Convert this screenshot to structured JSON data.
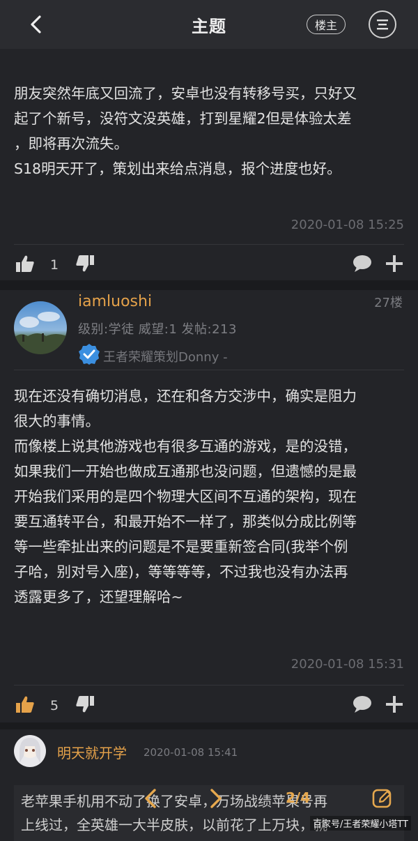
{
  "header": {
    "title": "主题",
    "owner_label": "楼主"
  },
  "post1": {
    "lines": [
      "朋友突然年底又回流了，安卓也没有转移号买，只好又",
      "起了个新号，没符文没英雄，打到星耀2但是体验太差",
      "，即将再次流失。",
      "S18明天开了，策划出来给点消息，报个进度也好。"
    ],
    "timestamp": "2020-01-08 15:25",
    "like_count": "1"
  },
  "post2": {
    "username": "iamluoshi",
    "floor": "27楼",
    "meta": "级别:学徒  威望:1  发帖:213",
    "badge_text": "王者荣耀策划Donny -",
    "lines": [
      "现在还没有确切消息，还在和各方交涉中，确实是阻力",
      "很大的事情。",
      "而像楼上说其他游戏也有很多互通的游戏，是的没错，",
      "如果我们一开始也做成互通那也没问题，但遗憾的是最",
      "开始我们采用的是四个物理大区间不互通的架构，现在",
      "要互通转平台，和最开始不一样了，那类似分成比例等",
      "等一些牵扯出来的问题是不是要重新签合同(我举个例",
      "子哈，别对号入座)，等等等等，不过我也没有办法再",
      "透露更多了，还望理解哈~"
    ],
    "timestamp": "2020-01-08 15:31",
    "like_count": "5"
  },
  "reply": {
    "username": "明天就开学",
    "time": "2020-01-08 15:41",
    "line1": "老苹果手机用不动了换了安卓，万场战绩苹果号再",
    "line2": "上线过，全英雄一大半皮肤，以前花了上万块，就"
  },
  "pager": {
    "page": "2/4"
  },
  "watermark": "百家号/王者荣耀小塔TT",
  "colors": {
    "background": "#232428",
    "accent": "#e5a24a",
    "badge": "#3b8fe0"
  }
}
